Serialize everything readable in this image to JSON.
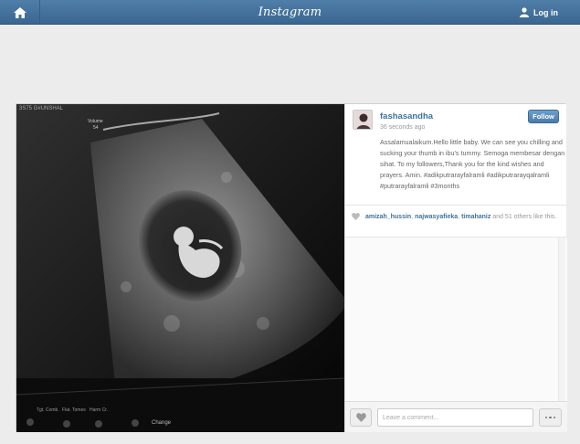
{
  "header": {
    "brand": "Instagram",
    "login_label": "Log in",
    "home_icon": "home-icon",
    "user_icon": "user-icon"
  },
  "post": {
    "username": "fashasandha",
    "time": "36 seconds ago",
    "follow_label": "Follow",
    "caption": "Assalamualaikum.Hello little baby. We can see you chilling and sucking your thumb in ibu's tummy. Semoga membesar dengan sihat. To my followers,Thank you for the kind wishes and prayers. Amin. #adikputrarayfalramli #adikputrarayqalramli #putrarayfalramli #3months",
    "likes": {
      "user1": "amizah_hussin",
      "sep1": ", ",
      "user2": "najwasyafieka",
      "sep2": ", ",
      "user3": "timahaniz",
      "rest": " and 51 others like this."
    },
    "comment_placeholder": "Leave a comment...",
    "ultrasound": {
      "top_left": "3S75 G#UNSHAL",
      "side_label1": "Volume",
      "side_label2": "54",
      "bottom_labels": [
        "Tgt. Comb.",
        "Flat. Tomes",
        "Harm Cr.",
        "Change"
      ]
    }
  },
  "colors": {
    "header": "#3a6791",
    "link": "#3f729b",
    "background": "#ececec"
  }
}
